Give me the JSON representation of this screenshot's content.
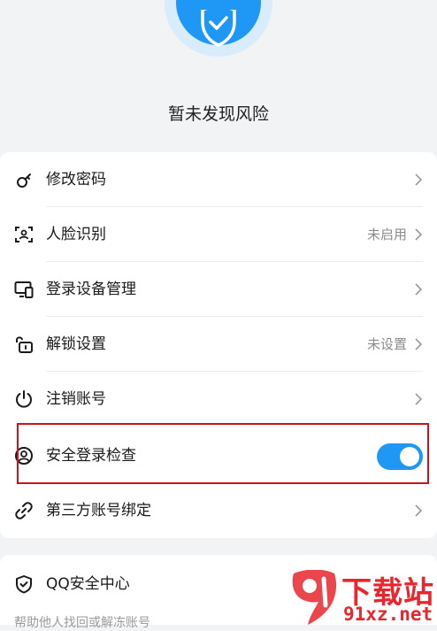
{
  "status": {
    "title": "暂未发现风险"
  },
  "security_items": [
    {
      "label": "修改密码",
      "value": "",
      "icon": "key-icon"
    },
    {
      "label": "人脸识别",
      "value": "未启用",
      "icon": "face-scan-icon"
    },
    {
      "label": "登录设备管理",
      "value": "",
      "icon": "devices-icon"
    },
    {
      "label": "解锁设置",
      "value": "未设置",
      "icon": "unlock-icon"
    },
    {
      "label": "注销账号",
      "value": "",
      "icon": "power-icon"
    },
    {
      "label": "安全登录检查",
      "toggle_on": true,
      "icon": "user-circle-icon"
    },
    {
      "label": "第三方账号绑定",
      "value": "",
      "icon": "link-icon"
    }
  ],
  "qq_center": {
    "label": "QQ安全中心",
    "icon": "shield-icon"
  },
  "footer": {
    "text": "帮助他人找回或解冻账号"
  },
  "watermark": {
    "title": "下载站",
    "url": "91xz.net"
  },
  "colors": {
    "accent": "#1e97f5",
    "highlight": "#d0121b",
    "watermark": "#e9262e"
  }
}
